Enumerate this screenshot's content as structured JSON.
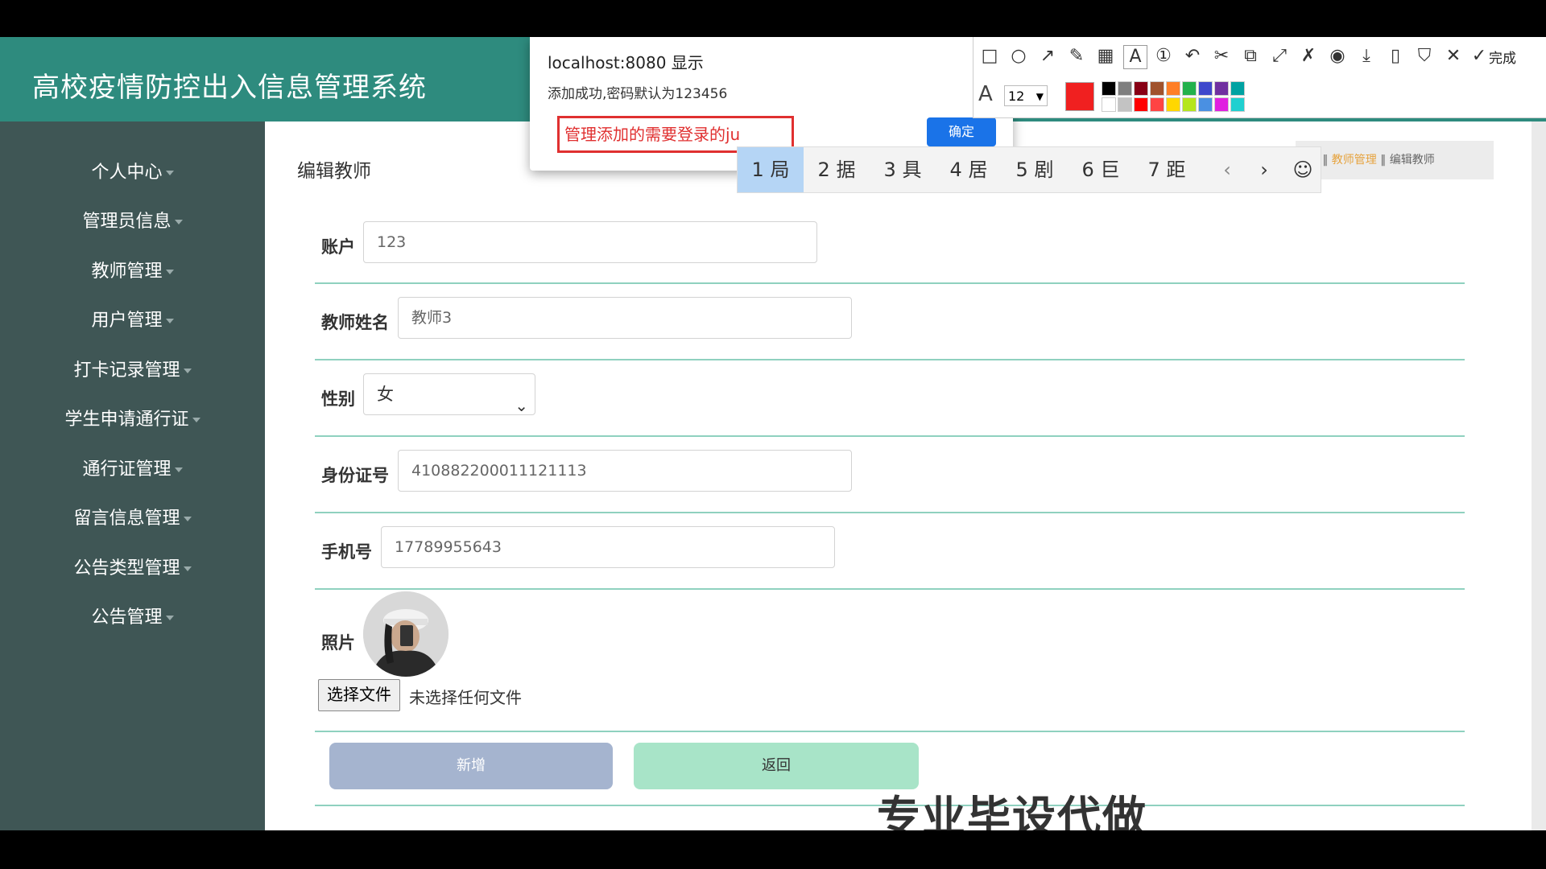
{
  "app_title": "高校疫情防控出入信息管理系统",
  "sidebar": {
    "items": [
      {
        "label": "个人中心"
      },
      {
        "label": "管理员信息"
      },
      {
        "label": "教师管理"
      },
      {
        "label": "用户管理"
      },
      {
        "label": "打卡记录管理"
      },
      {
        "label": "学生申请通行证"
      },
      {
        "label": "通行证管理"
      },
      {
        "label": "留言信息管理"
      },
      {
        "label": "公告类型管理"
      },
      {
        "label": "公告管理"
      }
    ]
  },
  "page": {
    "title": "编辑教师",
    "breadcrumb": [
      "教师管理",
      "编辑教师"
    ]
  },
  "form": {
    "account": {
      "label": "账户",
      "value": "123"
    },
    "teacher_name": {
      "label": "教师姓名",
      "value": "教师3"
    },
    "gender": {
      "label": "性别",
      "value": "女"
    },
    "id_number": {
      "label": "身份证号",
      "value": "410882200011121113"
    },
    "phone": {
      "label": "手机号",
      "value": "17789955643"
    },
    "photo": {
      "label": "照片",
      "file_button": "选择文件",
      "file_status": "未选择任何文件"
    },
    "submit_label": "新增",
    "back_label": "返回"
  },
  "watermark": "专业毕设代做",
  "dialog": {
    "title": "localhost:8080 显示",
    "message": "添加成功,密码默认为123456",
    "input_value": "管理添加的需要登录的ju",
    "ok_label": "确定"
  },
  "ime": {
    "candidates": [
      "1 局",
      "2 据",
      "3 具",
      "4 居",
      "5 剧",
      "6 巨",
      "7 距"
    ],
    "selected_index": 0
  },
  "toolbar": {
    "font_size": "12",
    "done_label": "完成",
    "current_color": "#f02020",
    "palette": [
      "#000000",
      "#7f7f7f",
      "#880015",
      "#a0522d",
      "#ff7f27",
      "#22b14c",
      "#3f48cc",
      "#7030a0",
      "#00a2a2",
      "#ffffff",
      "#c3c3c3",
      "#ff0000",
      "#ff4444",
      "#ffd700",
      "#b5e61d",
      "#4a90e2",
      "#e020e0",
      "#20d0d0"
    ]
  },
  "colors": {
    "header_bg": "#2e8b7e",
    "sidebar_bg": "#3f5655",
    "row_divider": "#8fd1bf",
    "submit_bg": "#a5b4cf",
    "back_bg": "#a8e4c8"
  }
}
